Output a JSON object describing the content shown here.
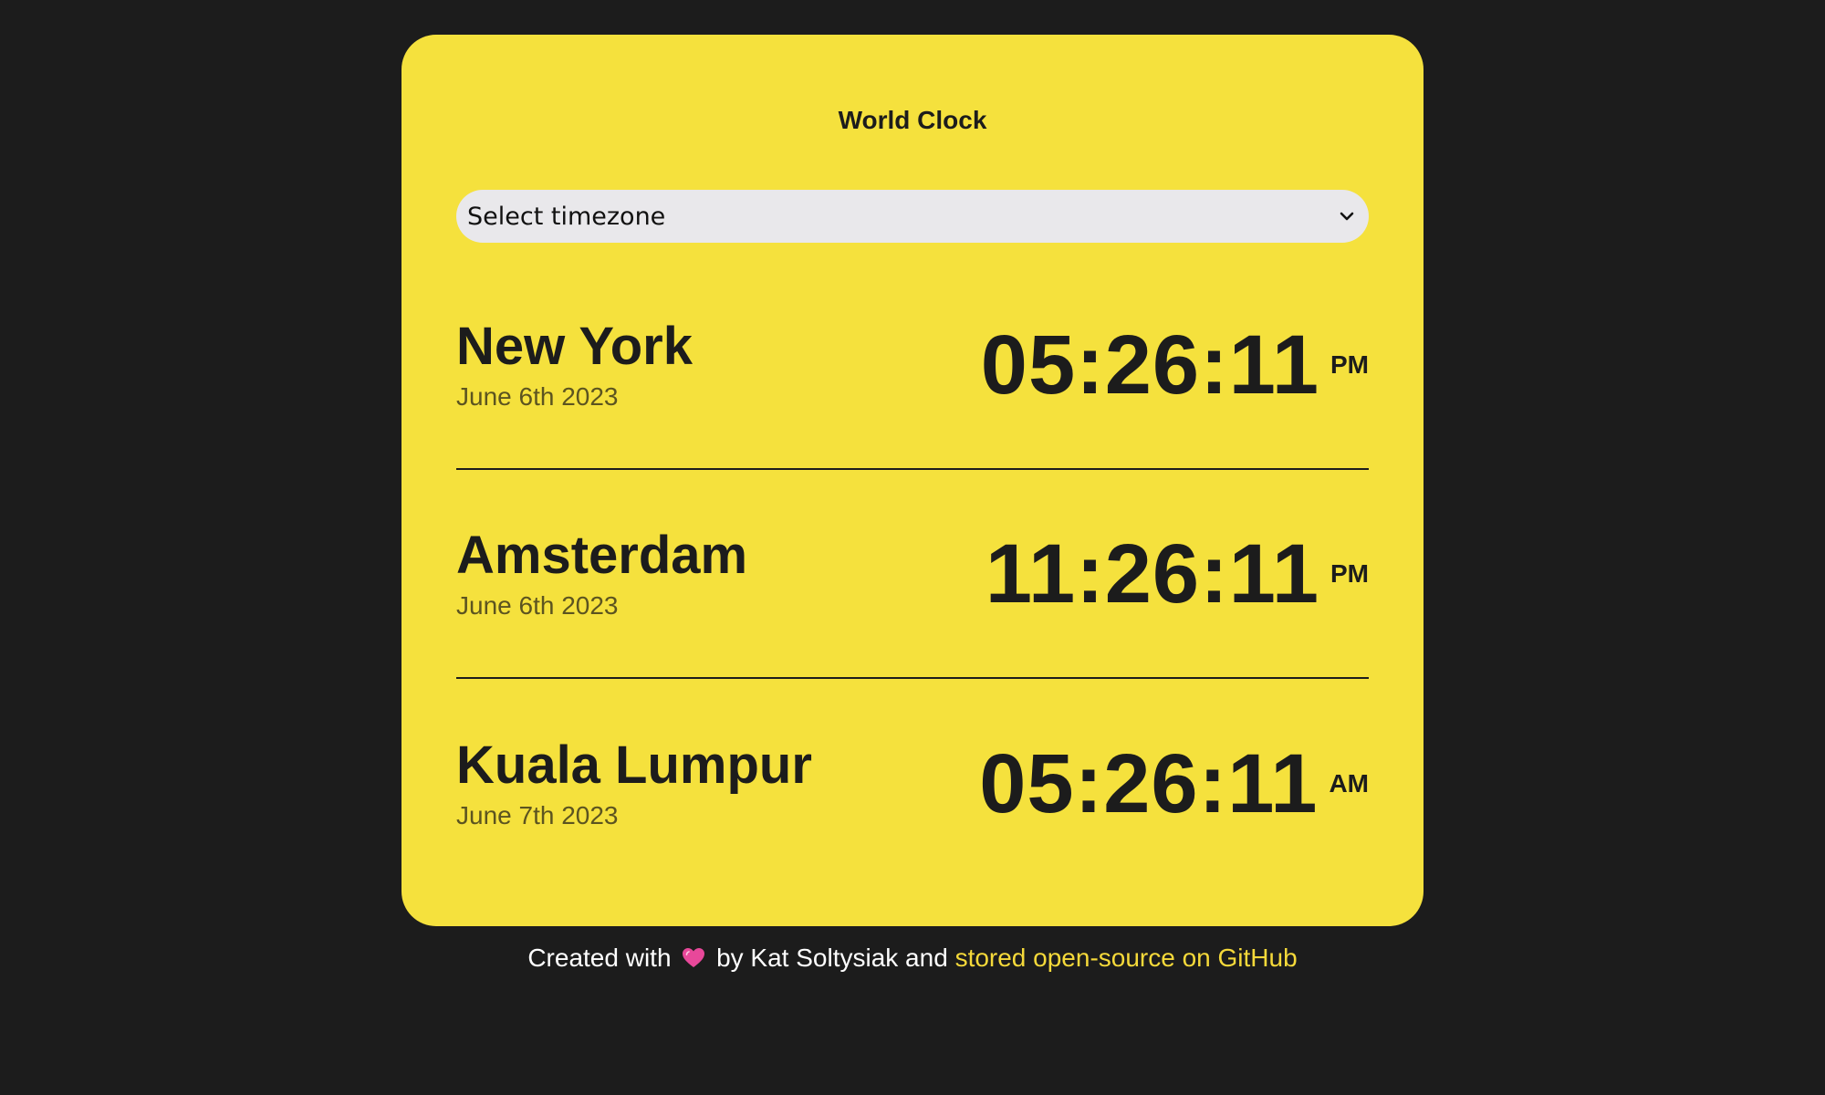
{
  "app": {
    "title": "World Clock"
  },
  "timezone_select": {
    "value": "Select timezone"
  },
  "cities": [
    {
      "name": "New York",
      "date": "June 6th 2023",
      "time": "05:26:11",
      "ampm": "PM"
    },
    {
      "name": "Amsterdam",
      "date": "June 6th 2023",
      "time": "11:26:11",
      "ampm": "PM"
    },
    {
      "name": "Kuala Lumpur",
      "date": "June 7th 2023",
      "time": "05:26:11",
      "ampm": "AM"
    }
  ],
  "footer": {
    "prefix": "Created with",
    "middle": "by Kat Soltysiak and",
    "link_text": "stored open-source on GitHub"
  },
  "colors": {
    "background": "#1c1c1c",
    "card": "#f5e13d",
    "link": "#f5d93a",
    "heart": "#e8489a"
  }
}
